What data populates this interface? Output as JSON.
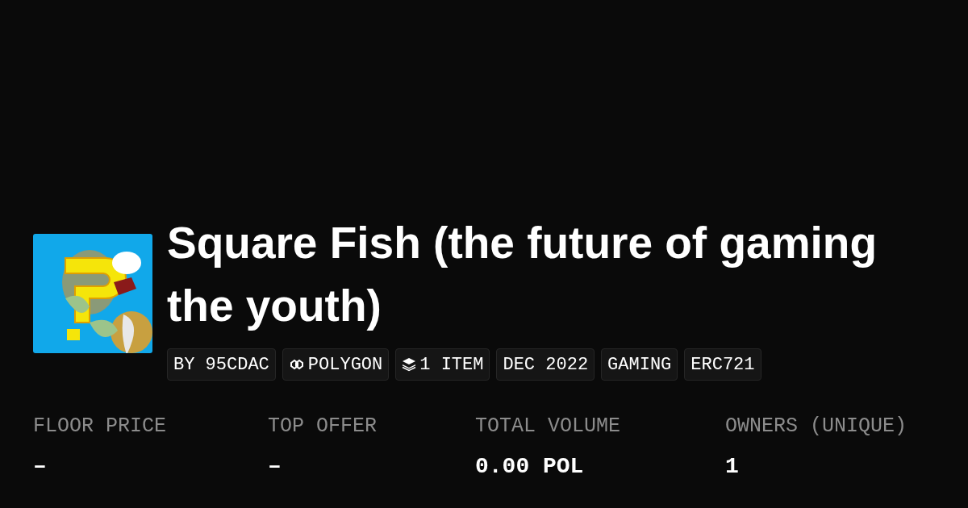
{
  "collection": {
    "title_lines": [
      "Square Fish (the future of gaming",
      "the youth)"
    ]
  },
  "chips": [
    {
      "kind": "text",
      "label": "BY 95CDAC"
    },
    {
      "kind": "chain",
      "label": "POLYGON"
    },
    {
      "kind": "items",
      "label": "1 ITEM"
    },
    {
      "kind": "text",
      "label": "DEC 2022"
    },
    {
      "kind": "text",
      "label": "GAMING"
    },
    {
      "kind": "text",
      "label": "ERC721"
    }
  ],
  "stats": [
    {
      "label": "FLOOR PRICE",
      "value": "–"
    },
    {
      "label": "TOP OFFER",
      "value": "–"
    },
    {
      "label": "TOTAL VOLUME",
      "value": "0.00 POL"
    },
    {
      "label": "OWNERS (UNIQUE)",
      "value": "1"
    }
  ]
}
